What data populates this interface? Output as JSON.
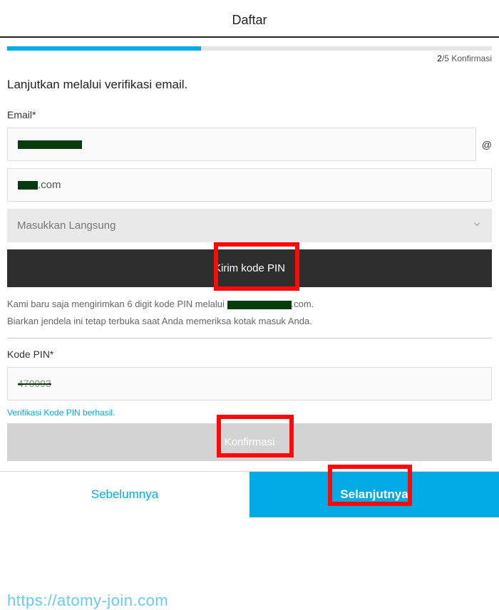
{
  "header": {
    "title": "Daftar"
  },
  "progress": {
    "step_current": "2",
    "step_total": "/5",
    "step_label": "Konfirmasi",
    "percent": 40
  },
  "subtitle": "Lanjutkan melalui verifikasi email.",
  "email": {
    "label": "Email*",
    "local_value": "",
    "at": "@",
    "domain_value": ".com",
    "select_value": "Masukkan Langsung",
    "send_pin_label": "Kirim kode PIN"
  },
  "sent_msg": {
    "line1_a": "Kami baru saja mengirimkan 6 digit kode PIN melalui ",
    "line1_b": ".com.",
    "line2": "Biarkan jendela ini tetap terbuka saat Anda memeriksa kotak masuk Anda."
  },
  "watermark": "https://atomy-join.com",
  "pin": {
    "label": "Kode PIN*",
    "value": "470093",
    "success": "Verifikasi Kode PIN berhasil.",
    "confirm_label": "Konfirmasi"
  },
  "nav": {
    "prev": "Sebelumnya",
    "next": "Selanjutnya"
  }
}
